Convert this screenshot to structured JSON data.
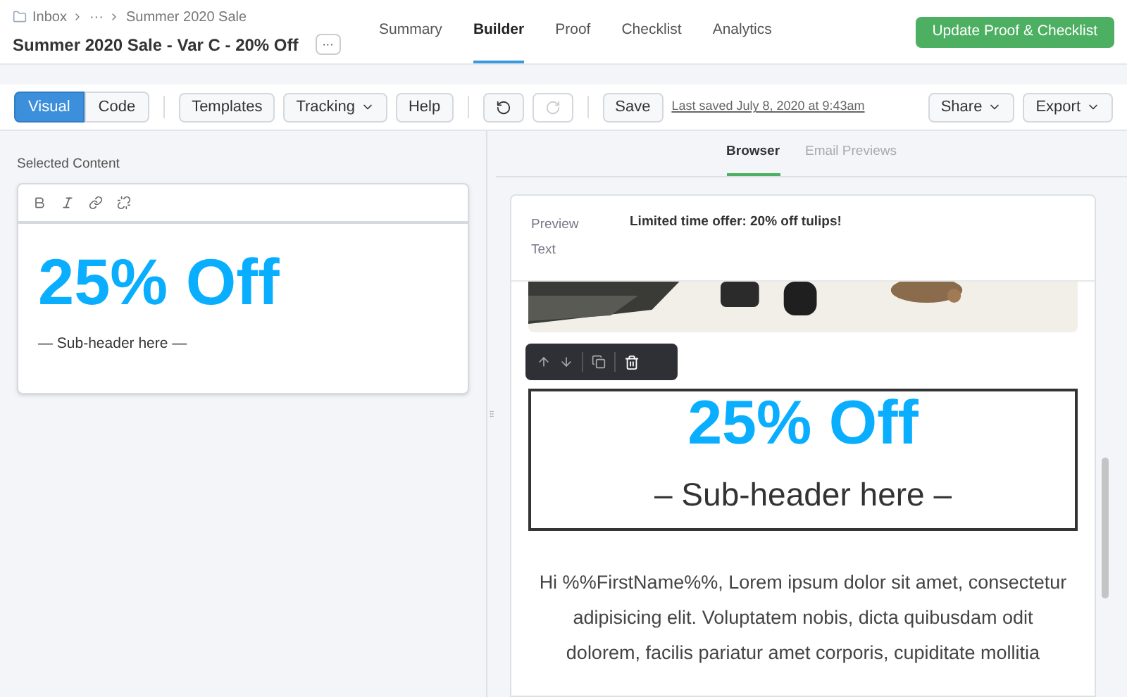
{
  "breadcrumbs": [
    "Inbox",
    "···",
    "Summer 2020 Sale"
  ],
  "title": "Summer 2020 Sale - Var C - 20% Off",
  "more_button": "···",
  "tabs": [
    {
      "label": "Summary",
      "selected": false
    },
    {
      "label": "Builder",
      "selected": true
    },
    {
      "label": "Proof",
      "selected": false
    },
    {
      "label": "Checklist",
      "selected": false
    },
    {
      "label": "Analytics",
      "selected": false
    }
  ],
  "primary_button": "Update Proof & Checklist",
  "toolbar": {
    "modes": [
      {
        "label": "Visual",
        "selected": true
      },
      {
        "label": "Code",
        "selected": false
      }
    ],
    "templates": "Templates",
    "tracking": "Tracking",
    "help": "Help",
    "redo_disabled": true,
    "save": "Save",
    "last_saved": "Last saved July 8, 2020 at 9:43am",
    "share": "Share",
    "export": "Export"
  },
  "editor": {
    "label": "Selected Content",
    "heading": "25% Off",
    "subheader": "— Sub-header here —"
  },
  "preview_tabs": [
    {
      "label": "Browser",
      "selected": true
    },
    {
      "label": "Email Previews",
      "selected": false
    }
  ],
  "preview": {
    "label": "Preview Text",
    "text": "Limited time offer: 20% off tulips!",
    "heading": "25% Off",
    "subheader": "– Sub-header here –",
    "body": "Hi %%FirstName%%, Lorem ipsum dolor sit amet, consectetur adipisicing elit. Voluptatem nobis, dicta quibusdam odit dolorem, facilis pariatur amet corporis, cupiditate mollitia"
  }
}
